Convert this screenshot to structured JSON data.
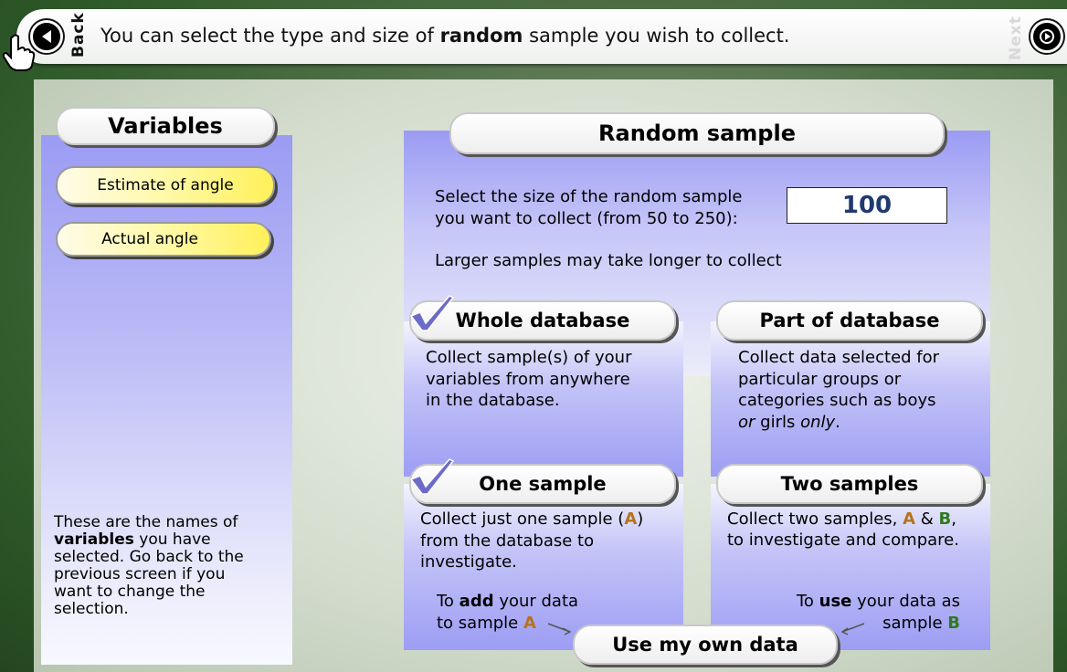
{
  "topbar": {
    "back_label": "Back",
    "next_label": "Next",
    "instruction": {
      "before": "You can select the type and size of ",
      "bold": "random",
      "after": " sample you wish to collect."
    }
  },
  "variables": {
    "title": "Variables",
    "items": [
      "Estimate of angle",
      "Actual angle"
    ],
    "help": {
      "line1": "These are the names of",
      "bold": "variables",
      "line2_rest": " you have",
      "line3": "selected. Go back to the",
      "line4": "previous screen if you",
      "line5": "want to change the",
      "line6": "selection."
    }
  },
  "random_sample": {
    "title": "Random sample",
    "size_prompt_line1": "Select the size of the random sample",
    "size_prompt_line2": "you want to collect (from 50 to 250):",
    "size_value": "100",
    "note": "Larger samples may take longer to collect"
  },
  "whole_database": {
    "title": "Whole database",
    "selected": true,
    "desc_line1": "Collect sample(s) of your",
    "desc_line2": "variables from anywhere",
    "desc_line3": "in the database."
  },
  "part_database": {
    "title": "Part of database",
    "selected": false,
    "desc_line1": "Collect data selected for",
    "desc_line2": "particular groups or",
    "desc_line3": "categories such as boys",
    "desc_line4_italic1": "or",
    "desc_line4_mid": " girls ",
    "desc_line4_italic2": "only",
    "desc_line4_end": "."
  },
  "one_sample": {
    "title": "One sample",
    "selected": true,
    "desc_line1_a": "Collect just one sample (",
    "label_a": "A",
    "desc_line1_b": ")",
    "desc_line2": "from the database to",
    "desc_line3": "investigate.",
    "add_line1_a": "To ",
    "add_bold": "add",
    "add_line1_b": " your data",
    "add_line2": "to sample ",
    "add_label": "A"
  },
  "two_samples": {
    "title": "Two samples",
    "selected": false,
    "desc_line1_a": "Collect two samples, ",
    "label_a": "A",
    "amp": " & ",
    "label_b": "B",
    "comma": ",",
    "desc_line2": "to investigate and compare.",
    "use_line1_a": "To ",
    "use_bold": "use",
    "use_line1_b": " your data as",
    "use_line2": "sample ",
    "use_label": "B"
  },
  "own_data_button": "Use my own data",
  "colors": {
    "panel_purple": "#9b9bf4",
    "sample_a": "#b5731c",
    "sample_b": "#2e7a1e",
    "check": "#6c6cc8",
    "size_value": "#203a70"
  }
}
